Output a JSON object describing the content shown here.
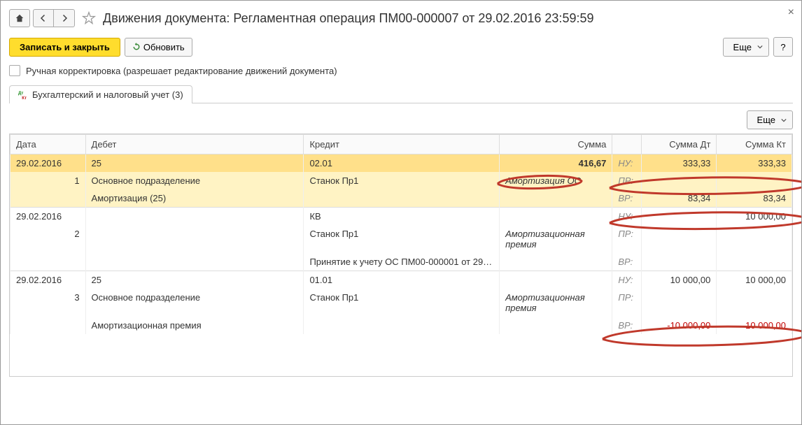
{
  "window": {
    "title": "Движения документа: Регламентная операция ПМ00-000007 от 29.02.2016 23:59:59"
  },
  "toolbar": {
    "primary": "Записать и закрыть",
    "refresh": "Обновить",
    "more": "Еще",
    "help": "?"
  },
  "checkbox_label": "Ручная корректировка (разрешает редактирование движений документа)",
  "tab": {
    "label": "Бухгалтерский и налоговый учет (3)"
  },
  "sub_more": "Еще",
  "headers": {
    "date": "Дата",
    "debit": "Дебет",
    "credit": "Кредит",
    "sum": "Сумма",
    "sum_dt": "Сумма Дт",
    "sum_kt": "Сумма Кт"
  },
  "tags": {
    "nu": "НУ:",
    "pr": "ПР:",
    "vr": "ВР:"
  },
  "rows": [
    {
      "date": "29.02.2016",
      "rownum": "1",
      "debit_acc": "25",
      "debit_sub1": "Основное подразделение",
      "debit_sub2": "Амортизация (25)",
      "credit_acc": "02.01",
      "credit_sub1": "Станок Пр1",
      "credit_sub2": "",
      "sum": "416,67",
      "desc": "Амортизация ОС",
      "nu_dt": "333,33",
      "nu_kt": "333,33",
      "pr_dt": "",
      "pr_kt": "",
      "vr_dt": "83,34",
      "vr_kt": "83,34"
    },
    {
      "date": "29.02.2016",
      "rownum": "2",
      "debit_acc": "",
      "debit_sub1": "",
      "debit_sub2": "",
      "credit_acc": "КВ",
      "credit_sub1": "Станок Пр1",
      "credit_sub2": "Принятие к учету ОС ПМ00-000001 от 29…",
      "sum": "",
      "desc": "Амортизационная премия",
      "nu_dt": "",
      "nu_kt": "10 000,00",
      "pr_dt": "",
      "pr_kt": "",
      "vr_dt": "",
      "vr_kt": ""
    },
    {
      "date": "29.02.2016",
      "rownum": "3",
      "debit_acc": "25",
      "debit_sub1": "Основное подразделение",
      "debit_sub2": "Амортизационная премия",
      "credit_acc": "01.01",
      "credit_sub1": "Станок Пр1",
      "credit_sub2": "",
      "sum": "",
      "desc": "Амортизационная премия",
      "nu_dt": "10 000,00",
      "nu_kt": "10 000,00",
      "pr_dt": "",
      "pr_kt": "",
      "vr_dt": "-10 000,00",
      "vr_kt": "-10 000,00"
    }
  ]
}
